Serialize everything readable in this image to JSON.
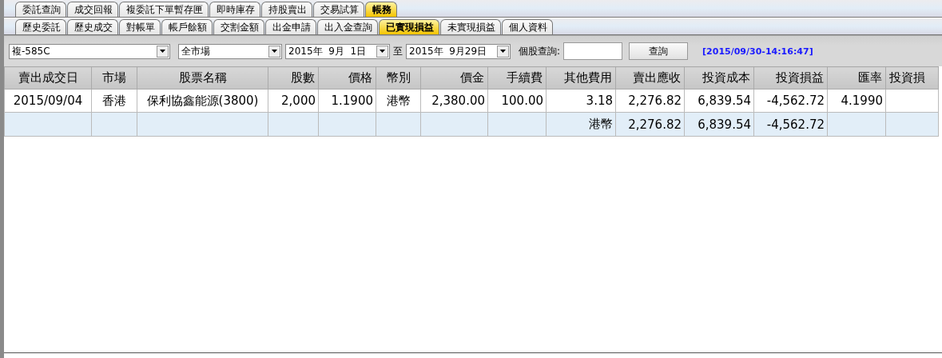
{
  "main_tabs": [
    {
      "label": "委託查詢",
      "selected": false
    },
    {
      "label": "成交回報",
      "selected": false
    },
    {
      "label": "複委託下單暫存匣",
      "selected": false
    },
    {
      "label": "即時庫存",
      "selected": false
    },
    {
      "label": "持股賣出",
      "selected": false
    },
    {
      "label": "交易試算",
      "selected": false
    },
    {
      "label": "帳務",
      "selected": true
    }
  ],
  "sub_tabs": [
    {
      "label": "歷史委託",
      "selected": false
    },
    {
      "label": "歷史成交",
      "selected": false
    },
    {
      "label": "對帳單",
      "selected": false
    },
    {
      "label": "帳戶餘額",
      "selected": false
    },
    {
      "label": "交割金額",
      "selected": false
    },
    {
      "label": "出金申請",
      "selected": false
    },
    {
      "label": "出入金查詢",
      "selected": false
    },
    {
      "label": "已實現損益",
      "selected": true
    },
    {
      "label": "未實現損益",
      "selected": false
    },
    {
      "label": "個人資料",
      "selected": false
    }
  ],
  "toolbar": {
    "account": "複-585C",
    "market": "全市場",
    "date_from": "2015年  9月  1日",
    "to_label": "至",
    "date_to": "2015年  9月29日",
    "stock_query_label": "個股查詢:",
    "query_button": "查詢",
    "timestamp": "[2015/09/30-14:16:47]"
  },
  "table": {
    "columns": [
      "賣出成交日",
      "市場",
      "股票名稱",
      "股數",
      "價格",
      "幣別",
      "價金",
      "手續費",
      "其他費用",
      "賣出應收",
      "投資成本",
      "投資損益",
      "匯率",
      "投資損"
    ],
    "rows": [
      {
        "cells": [
          "2015/09/04",
          "香港",
          "保利協鑫能源(3800)",
          "2,000",
          "1.1900",
          "港幣",
          "2,380.00",
          "100.00",
          "3.18",
          "2,276.82",
          "6,839.54",
          "-4,562.72",
          "4.1990"
        ]
      }
    ],
    "totals": {
      "currency": "港幣",
      "receivable": "2,276.82",
      "cost": "6,839.54",
      "pnl": "-4,562.72"
    }
  }
}
